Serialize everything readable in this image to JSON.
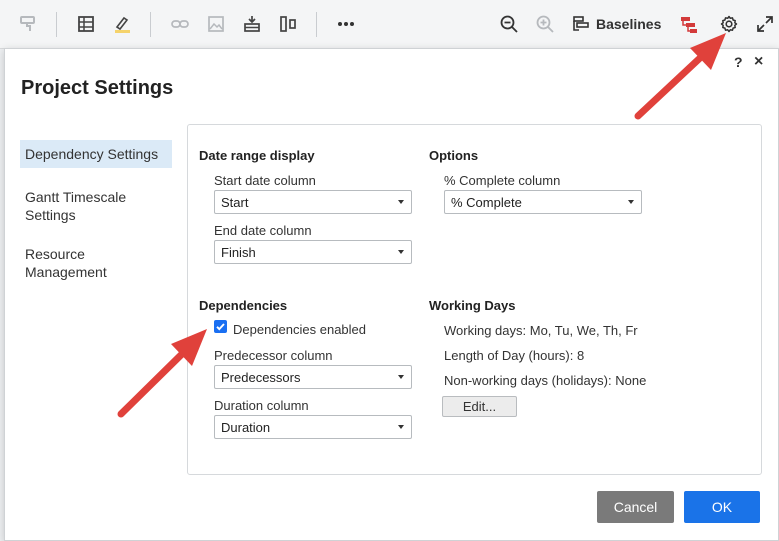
{
  "toolbar": {
    "baselines_label": "Baselines",
    "icons": [
      "format-painter-icon",
      "grid-icon",
      "highlight-icon",
      "link-icon",
      "image-icon",
      "insert-row-icon",
      "columns-icon",
      "more-icon",
      "zoom-out-icon",
      "zoom-in-icon",
      "baselines-icon",
      "critical-path-icon",
      "settings-gear-icon",
      "expand-icon"
    ]
  },
  "dialog": {
    "title": "Project Settings",
    "help": "?",
    "close": "×",
    "nav": [
      {
        "label": "Dependency Settings",
        "active": true
      },
      {
        "label": "Gantt Timescale Settings",
        "active": false
      },
      {
        "label": "Resource Management",
        "active": false
      }
    ],
    "date_range": {
      "title": "Date range display",
      "start_label": "Start date column",
      "start_value": "Start",
      "end_label": "End date column",
      "end_value": "Finish"
    },
    "options": {
      "title": "Options",
      "complete_label": "% Complete column",
      "complete_value": "% Complete"
    },
    "dependencies": {
      "title": "Dependencies",
      "enabled_label": "Dependencies enabled",
      "enabled": true,
      "predecessor_label": "Predecessor column",
      "predecessor_value": "Predecessors",
      "duration_label": "Duration column",
      "duration_value": "Duration"
    },
    "working_days": {
      "title": "Working Days",
      "days": "Working days: Mo, Tu, We, Th, Fr",
      "length": "Length of Day (hours): 8",
      "holidays": "Non-working days (holidays): None",
      "edit_label": "Edit..."
    },
    "cancel_label": "Cancel",
    "ok_label": "OK"
  },
  "colors": {
    "accent": "#1a73e8",
    "arrow": "#e0413b",
    "nav_active": "#dbeaf7",
    "cancel": "#7a7a7a"
  }
}
